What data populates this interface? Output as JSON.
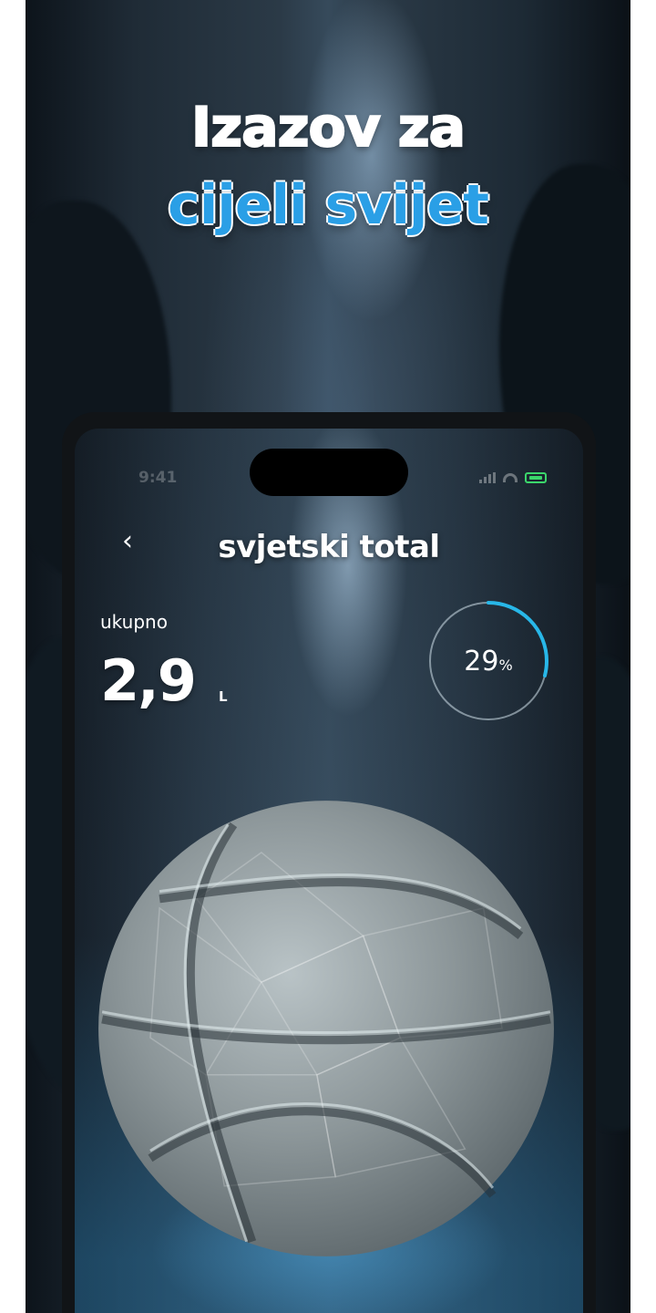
{
  "promo": {
    "headline_line1": "Izazov za",
    "headline_line2": "cijeli svijet"
  },
  "status_bar": {
    "time": "9:41",
    "signal_icon": "signal-icon",
    "wifi_icon": "wifi-icon",
    "battery_icon": "battery-icon"
  },
  "header": {
    "back_icon": "chevron-left-icon",
    "back_glyph": "‹",
    "title": "svjetski total"
  },
  "stats": {
    "total_label": "ukupno",
    "total_value": "2,9",
    "total_unit": "L",
    "progress_number": "29",
    "progress_suffix": "%",
    "progress_fraction": 0.29
  },
  "colors": {
    "headline_blue": "#2a9fe6",
    "ring_accent": "#28b7e8",
    "battery_green": "#3bd66b"
  },
  "illustration": {
    "icon": "crystal-basketball-icon"
  }
}
